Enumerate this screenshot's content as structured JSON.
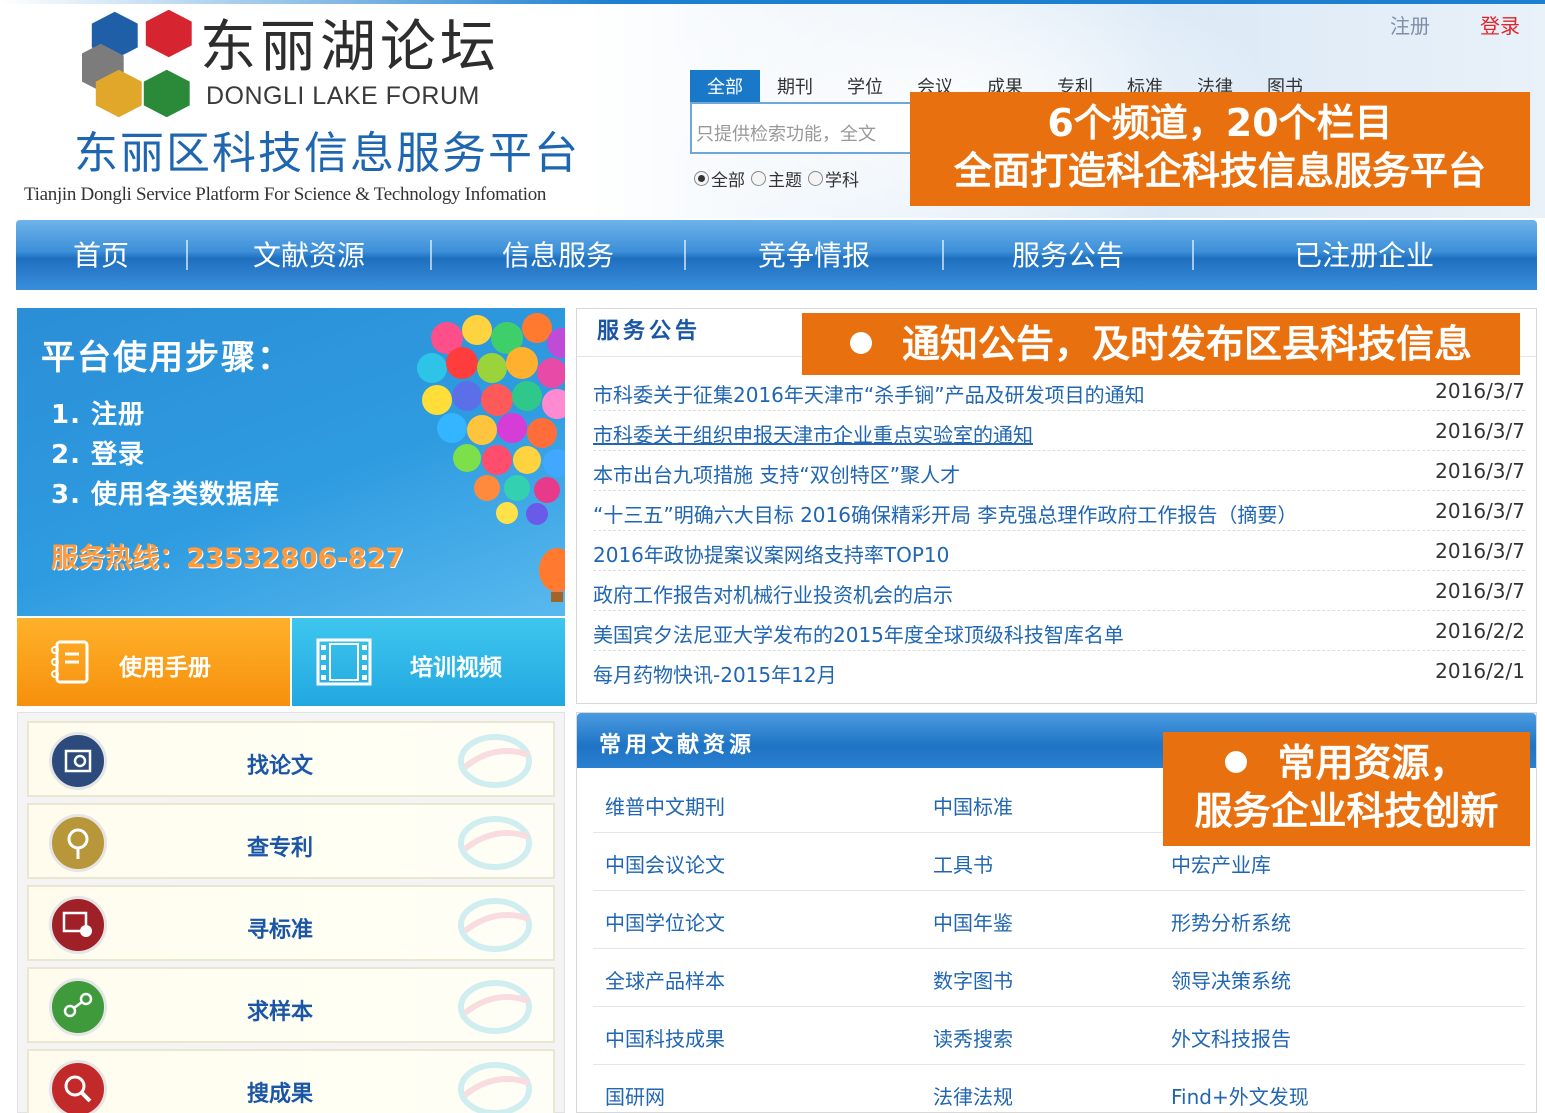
{
  "header": {
    "logo_cn": "东丽湖论坛",
    "logo_en": "DONGLI LAKE FORUM",
    "platform_cn": "东丽区科技信息服务平台",
    "platform_en": "Tianjin Dongli Service Platform For Science & Technology Infomation",
    "register": "注册",
    "login": "登录",
    "logo_colors": [
      "#d62530",
      "#1e5fa8",
      "#7c7c7c",
      "#e0a72a",
      "#2a8a3a"
    ]
  },
  "search": {
    "tabs": [
      "全部",
      "期刊",
      "学位",
      "会议",
      "成果",
      "专利",
      "标准",
      "法律",
      "图书"
    ],
    "active_tab": 0,
    "placeholder": "只提供检索功能，全文",
    "radios": [
      "全部",
      "主题",
      "学科"
    ],
    "selected_radio": 0
  },
  "callouts": {
    "c1_line1": "6个频道，20个栏目",
    "c1_line2": "全面打造科企科技信息服务平台",
    "c2": "通知公告，及时发布区县科技信息",
    "c3_line1": "常用资源，",
    "c3_line2": "服务企业科技创新",
    "color": "#e8700f"
  },
  "nav": {
    "items": [
      "首页",
      "文献资源",
      "信息服务",
      "竞争情报",
      "服务公告",
      "已注册企业"
    ]
  },
  "banner": {
    "title": "平台使用步骤：",
    "steps": [
      "1. 注册",
      "2. 登录",
      "3. 使用各类数据库"
    ],
    "hotline": "服务热线：23532806-827"
  },
  "quick_buttons": {
    "manual": "使用手册",
    "video": "培训视频"
  },
  "services": [
    {
      "label": "找论文",
      "icon": "paper-search-icon",
      "color": "#2c4a7c"
    },
    {
      "label": "查专利",
      "icon": "patent-magnifier-icon",
      "color": "#b8963a"
    },
    {
      "label": "寻标准",
      "icon": "standard-book-icon",
      "color": "#a02028"
    },
    {
      "label": "求样本",
      "icon": "sample-molecule-icon",
      "color": "#3e9a3a"
    },
    {
      "label": "搜成果",
      "icon": "result-search-icon",
      "color": "#c22a2a"
    }
  ],
  "notices": {
    "title": "服务公告",
    "items": [
      {
        "text": "市科委关于征集2016年天津市“杀手锏”产品及研发项目的通知",
        "date": "2016/3/7"
      },
      {
        "text": "市科委关于组织申报天津市企业重点实验室的通知",
        "date": "2016/3/7"
      },
      {
        "text": "本市出台九项措施 支持“双创特区”聚人才",
        "date": "2016/3/7"
      },
      {
        "text": "“十三五”明确六大目标 2016确保精彩开局 李克强总理作政府工作报告（摘要）",
        "date": "2016/3/7"
      },
      {
        "text": "2016年政协提案议案网络支持率TOP10",
        "date": "2016/3/7"
      },
      {
        "text": "政府工作报告对机械行业投资机会的启示",
        "date": "2016/3/7"
      },
      {
        "text": "美国宾夕法尼亚大学发布的2015年度全球顶级科技智库名单",
        "date": "2016/2/2"
      },
      {
        "text": "每月药物快讯-2015年12月",
        "date": "2016/2/1"
      }
    ]
  },
  "resources": {
    "title": "常用文献资源",
    "rows": [
      [
        "维普中文期刊",
        "中国标准",
        ""
      ],
      [
        "中国会议论文",
        "工具书",
        "中宏产业库"
      ],
      [
        "中国学位论文",
        "中国年鉴",
        "形势分析系统"
      ],
      [
        "全球产品样本",
        "数字图书",
        "领导决策系统"
      ],
      [
        "中国科技成果",
        "读秀搜索",
        "外文科技报告"
      ],
      [
        "国研网",
        "法律法规",
        "Find+外文发现"
      ]
    ]
  }
}
